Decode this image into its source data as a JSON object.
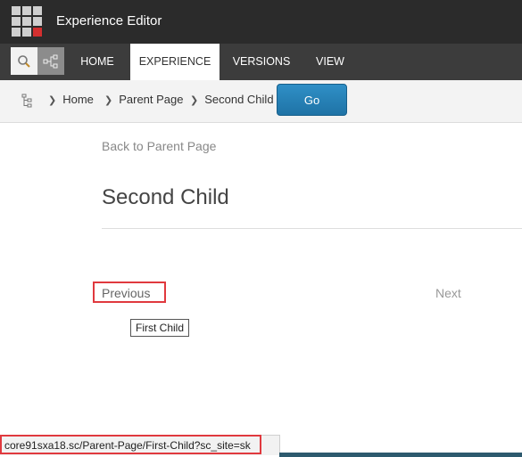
{
  "app": {
    "title": "Experience Editor",
    "launcher_icon": "app-grid-icon"
  },
  "toolbar": {
    "search_icon": "search-icon",
    "tree_icon": "tree-structure-icon"
  },
  "tabs": [
    {
      "label": "HOME",
      "active": false
    },
    {
      "label": "EXPERIENCE",
      "active": true
    },
    {
      "label": "VERSIONS",
      "active": false
    },
    {
      "label": "VIEW",
      "active": false
    }
  ],
  "breadcrumb": {
    "items": [
      "Home",
      "Parent Page",
      "Second Child"
    ],
    "go_label": "Go"
  },
  "page": {
    "back_link": "Back to Parent Page",
    "title": "Second Child",
    "previous_label": "Previous",
    "next_label": "Next",
    "tooltip": "First Child"
  },
  "status": {
    "url": "core91sxa18.sc/Parent-Page/First-Child?sc_site=sk"
  },
  "colors": {
    "accent": "#1f73a6",
    "highlight": "#e0393e",
    "titlebar": "#2b2b2b"
  }
}
